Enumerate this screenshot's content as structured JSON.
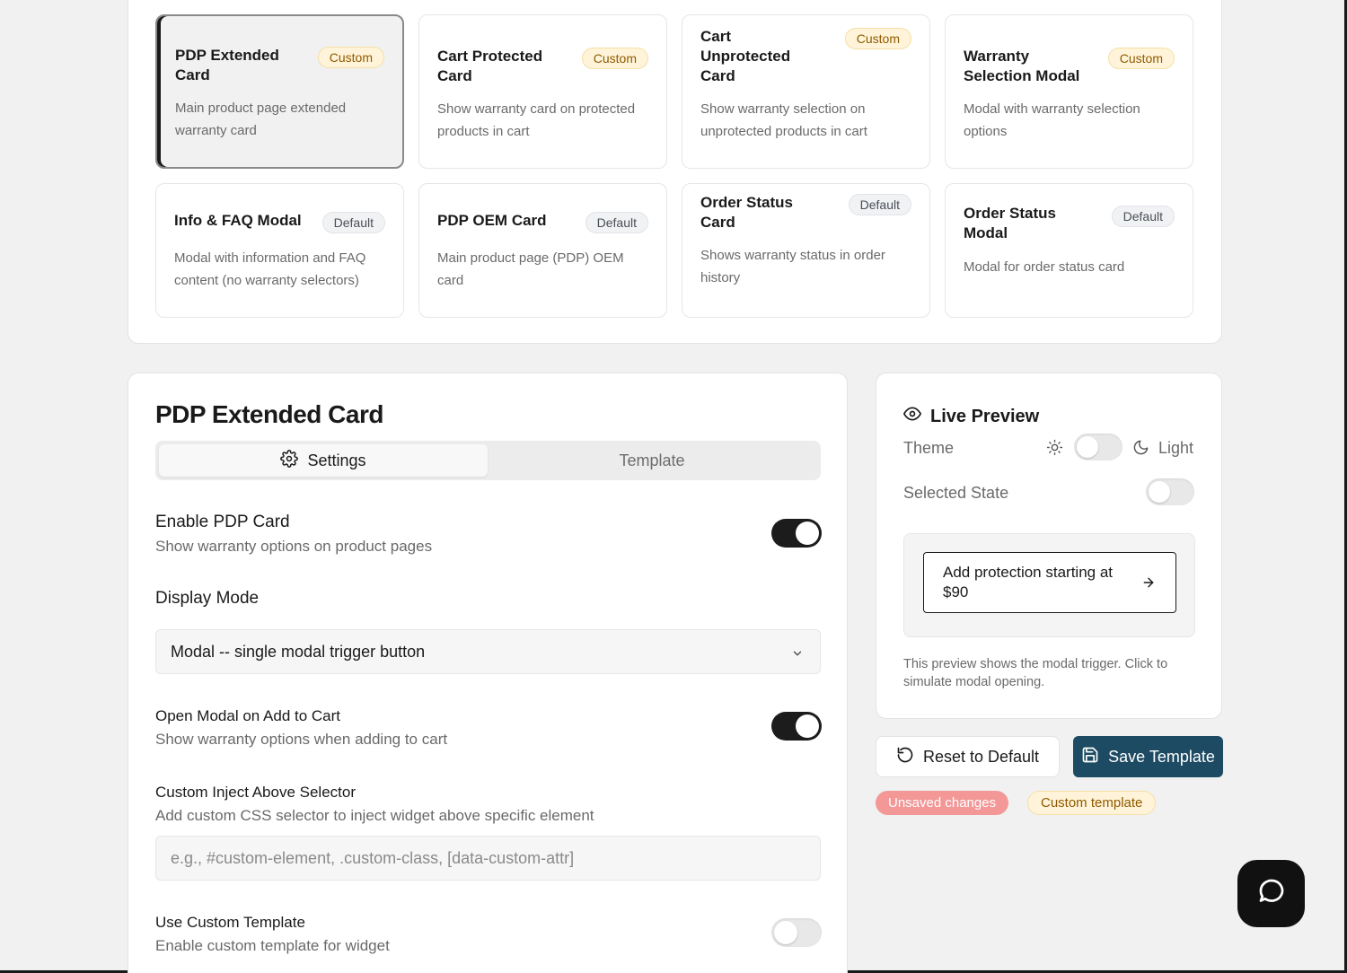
{
  "templates": [
    {
      "title": "PDP Extended Card",
      "badge": "Custom",
      "desc": "Main product page extended warranty card"
    },
    {
      "title": "Cart Protected Card",
      "badge": "Custom",
      "desc": "Show warranty card on protected products in cart"
    },
    {
      "title": "Cart Unprotected Card",
      "badge": "Custom",
      "desc": "Show warranty selection on unprotected products in cart"
    },
    {
      "title": "Warranty Selection Modal",
      "badge": "Custom",
      "desc": "Modal with warranty selection options"
    },
    {
      "title": "Info & FAQ Modal",
      "badge": "Default",
      "desc": "Modal with information and FAQ content (no warranty selectors)"
    },
    {
      "title": "PDP OEM Card",
      "badge": "Default",
      "desc": "Main product page (PDP) OEM card"
    },
    {
      "title": "Order Status Card",
      "badge": "Default",
      "desc": "Shows warranty status in order history"
    },
    {
      "title": "Order Status Modal",
      "badge": "Default",
      "desc": "Modal for order status card"
    }
  ],
  "settings": {
    "title": "PDP Extended Card",
    "tabs": [
      "Settings",
      "Template"
    ],
    "enable_pdp": {
      "label": "Enable PDP Card",
      "sub": "Show warranty options on product pages",
      "on": true
    },
    "display_mode": {
      "label": "Display Mode",
      "value": "Modal -- single modal trigger button"
    },
    "open_modal": {
      "label": "Open Modal on Add to Cart",
      "sub": "Show warranty options when adding to cart",
      "on": true
    },
    "inject": {
      "label": "Custom Inject Above Selector",
      "sub": "Add custom CSS selector to inject widget above specific element",
      "placeholder": "e.g., #custom-element, .custom-class, [data-custom-attr]",
      "value": ""
    },
    "custom_template": {
      "label": "Use Custom Template",
      "sub": "Enable custom template for widget",
      "on": false
    }
  },
  "preview": {
    "title": "Live Preview",
    "theme_label": "Theme",
    "theme_value": "Light",
    "selected_state_label": "Selected State",
    "trigger_text": "Add protection starting at $90",
    "note": "This preview shows the modal trigger. Click to simulate modal opening."
  },
  "actions": {
    "reset": "Reset to Default",
    "save": "Save Template",
    "unsaved": "Unsaved changes",
    "custom_template": "Custom template"
  },
  "colors": {
    "accent": "#1d4b63",
    "custom_badge_bg": "#fff4d9",
    "unsaved_bg": "#f39797"
  }
}
